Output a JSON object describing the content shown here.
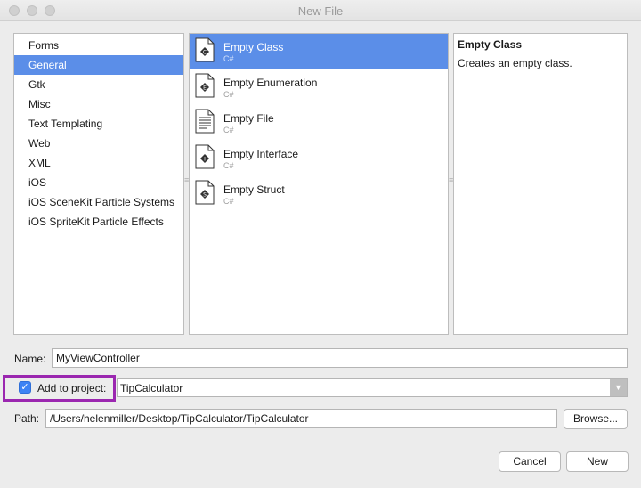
{
  "window": {
    "title": "New File"
  },
  "categories": [
    {
      "label": "Forms",
      "selected": false
    },
    {
      "label": "General",
      "selected": true
    },
    {
      "label": "Gtk",
      "selected": false
    },
    {
      "label": "Misc",
      "selected": false
    },
    {
      "label": "Text Templating",
      "selected": false
    },
    {
      "label": "Web",
      "selected": false
    },
    {
      "label": "XML",
      "selected": false
    },
    {
      "label": "iOS",
      "selected": false
    },
    {
      "label": "iOS SceneKit Particle Systems",
      "selected": false
    },
    {
      "label": "iOS SpriteKit Particle Effects",
      "selected": false
    }
  ],
  "templates": [
    {
      "name": "Empty Class",
      "lang": "C#",
      "icon": "class-file-icon",
      "glyph": "C",
      "selected": true
    },
    {
      "name": "Empty Enumeration",
      "lang": "C#",
      "icon": "enum-file-icon",
      "glyph": "E",
      "selected": false
    },
    {
      "name": "Empty File",
      "lang": "C#",
      "icon": "text-file-icon",
      "glyph": "",
      "selected": false
    },
    {
      "name": "Empty Interface",
      "lang": "C#",
      "icon": "interface-file-icon",
      "glyph": "I",
      "selected": false
    },
    {
      "name": "Empty Struct",
      "lang": "C#",
      "icon": "struct-file-icon",
      "glyph": "S",
      "selected": false
    }
  ],
  "description": {
    "title": "Empty Class",
    "text": "Creates an empty class."
  },
  "form": {
    "name_label": "Name:",
    "name_value": "MyViewController",
    "add_to_project_label": "Add to project:",
    "add_to_project_checked": true,
    "project_value": "TipCalculator",
    "path_label": "Path:",
    "path_value": "/Users/helenmiller/Desktop/TipCalculator/TipCalculator",
    "browse_label": "Browse..."
  },
  "buttons": {
    "cancel": "Cancel",
    "new": "New"
  },
  "colors": {
    "selection": "#5b8ee8",
    "highlight_box": "#9b27b0",
    "checkbox": "#3d83f4"
  }
}
